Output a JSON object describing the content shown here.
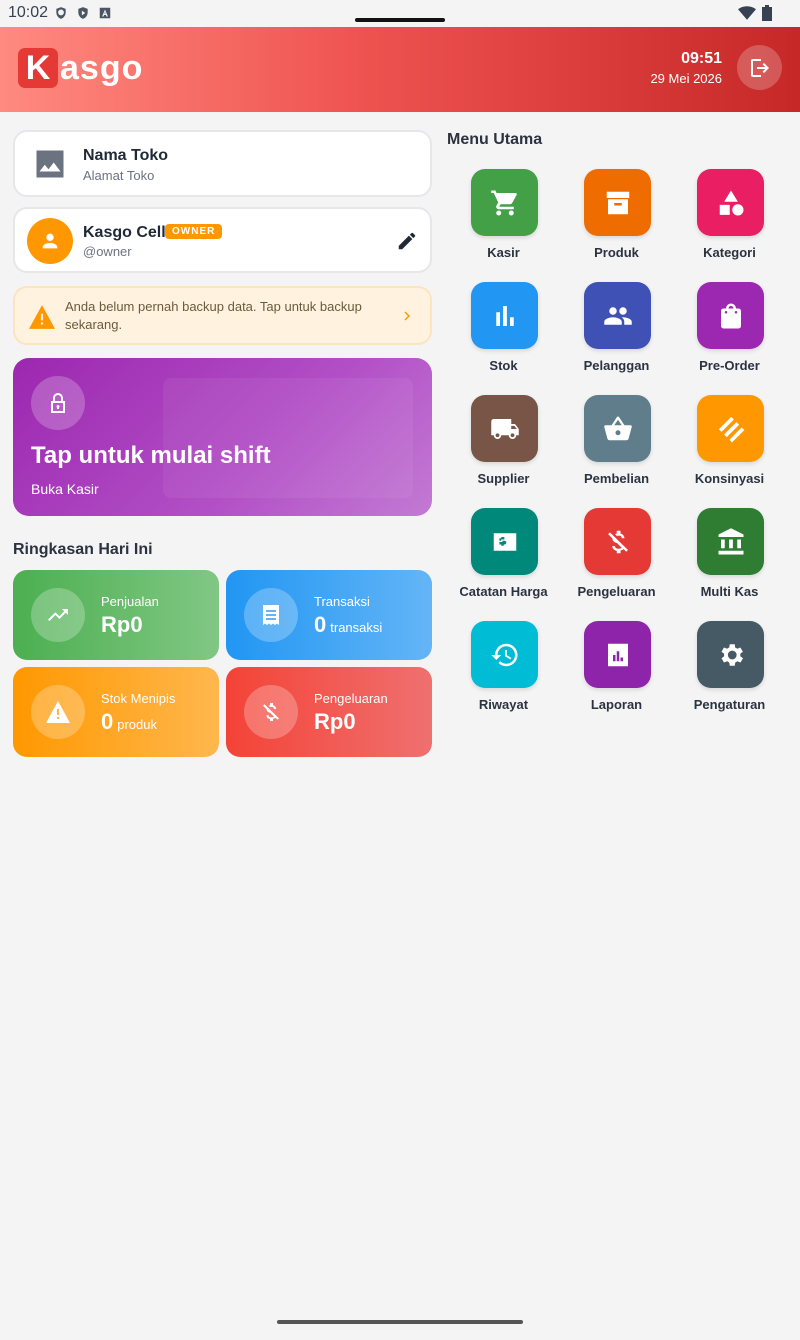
{
  "status_bar": {
    "time": "10:02"
  },
  "header": {
    "logo_k": "K",
    "logo_rest": "asgo",
    "time": "09:51",
    "date": "29 Mei 2026"
  },
  "store": {
    "name": "Nama Toko",
    "address": "Alamat Toko"
  },
  "user": {
    "name": "Kasgo Cell",
    "role_badge": "OWNER",
    "handle": "@owner"
  },
  "backup_notice": {
    "text": "Anda belum pernah backup data. Tap untuk backup sekarang."
  },
  "shift": {
    "title": "Tap untuk mulai shift",
    "subtitle": "Buka Kasir"
  },
  "summary": {
    "title": "Ringkasan Hari Ini",
    "sales": {
      "label": "Penjualan",
      "value": "Rp0"
    },
    "transactions": {
      "label": "Transaksi",
      "value": "0",
      "unit": "transaksi"
    },
    "low_stock": {
      "label": "Stok Menipis",
      "value": "0",
      "unit": "produk"
    },
    "expenses": {
      "label": "Pengeluaran",
      "value": "Rp0"
    }
  },
  "menu": {
    "title": "Menu Utama",
    "items": [
      {
        "label": "Kasir",
        "icon": "cart-icon",
        "color": "#43a047"
      },
      {
        "label": "Produk",
        "icon": "archive-box-icon",
        "color": "#ef6c00"
      },
      {
        "label": "Kategori",
        "icon": "category-shapes-icon",
        "color": "#e91e63"
      },
      {
        "label": "Stok",
        "icon": "bar-chart-icon",
        "color": "#2196f3"
      },
      {
        "label": "Pelanggan",
        "icon": "people-icon",
        "color": "#3f51b5"
      },
      {
        "label": "Pre-Order",
        "icon": "shopping-bag-icon",
        "color": "#9c27b0"
      },
      {
        "label": "Supplier",
        "icon": "truck-icon",
        "color": "#795548"
      },
      {
        "label": "Pembelian",
        "icon": "basket-icon",
        "color": "#607d8b"
      },
      {
        "label": "Konsinyasi",
        "icon": "handshake-icon",
        "color": "#ff9800"
      },
      {
        "label": "Catatan Harga",
        "icon": "price-tag-icon",
        "color": "#00897b"
      },
      {
        "label": "Pengeluaran",
        "icon": "money-off-icon",
        "color": "#e53935"
      },
      {
        "label": "Multi Kas",
        "icon": "bank-icon",
        "color": "#2e7d32"
      },
      {
        "label": "Riwayat",
        "icon": "history-icon",
        "color": "#00bcd4"
      },
      {
        "label": "Laporan",
        "icon": "report-icon",
        "color": "#8e24aa"
      },
      {
        "label": "Pengaturan",
        "icon": "gear-icon",
        "color": "#455a64"
      }
    ]
  }
}
